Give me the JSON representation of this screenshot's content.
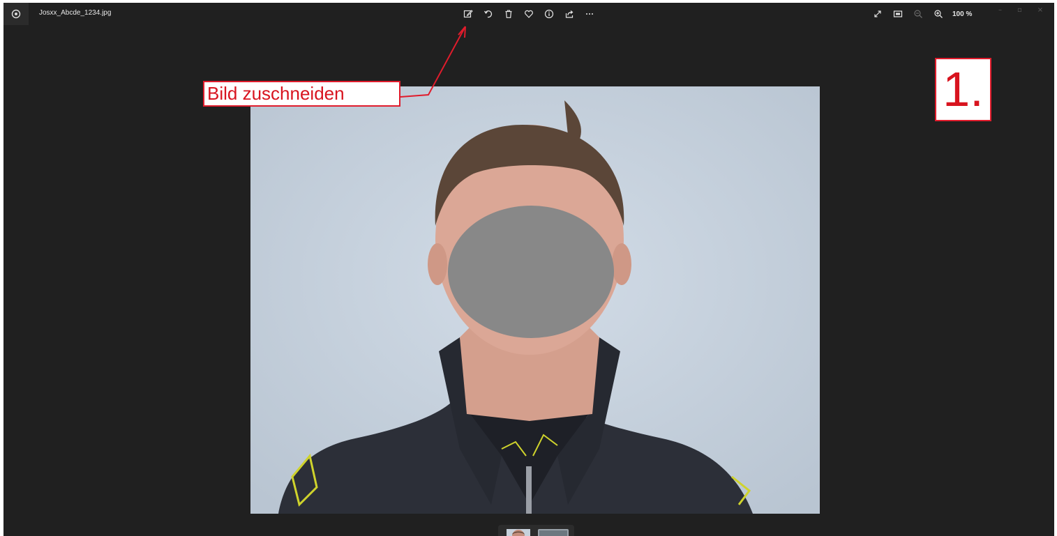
{
  "titlebar": {
    "app_icon": "photos-app-icon",
    "filename": "Josxx_Abcde_1234.jpg"
  },
  "toolbar": {
    "items": [
      {
        "name": "edit-image-icon",
        "tooltip": ""
      },
      {
        "name": "rotate-icon"
      },
      {
        "name": "delete-icon"
      },
      {
        "name": "favorite-heart-icon"
      },
      {
        "name": "info-icon"
      },
      {
        "name": "share-icon"
      },
      {
        "name": "more-options-icon"
      }
    ]
  },
  "view_tools": {
    "zoom_level": "100 %"
  },
  "window_controls": {
    "minimize": "–",
    "maximize": "▫",
    "close": "×"
  },
  "annotations": {
    "callout_text": "Bild zuschneiden",
    "step_label": "1."
  },
  "colors": {
    "background": "#202020",
    "annotation_red": "#e01c2c",
    "photo_wall": "#c8d3df",
    "face_blur": "#888888"
  }
}
